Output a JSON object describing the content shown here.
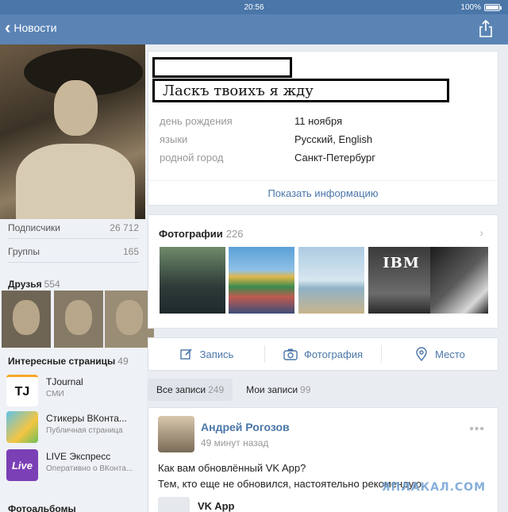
{
  "status_bar": {
    "time": "20:56",
    "battery": "100%"
  },
  "nav": {
    "back_label": "Новости"
  },
  "profile": {
    "status_text": "Ласкъ твоихъ я жду",
    "info": [
      {
        "key": "день рождения",
        "value": "11 ноября"
      },
      {
        "key": "языки",
        "value": "Русский, English"
      },
      {
        "key": "родной город",
        "value": "Санкт-Петербург"
      }
    ],
    "show_more": "Показать информацию"
  },
  "sidebar": {
    "stats": [
      {
        "label": "Подписчики",
        "value": "26 712"
      },
      {
        "label": "Группы",
        "value": "165"
      }
    ],
    "friends": {
      "title": "Друзья",
      "count": "554"
    },
    "interesting": {
      "title": "Интересные страницы",
      "count": "49"
    },
    "pages": [
      {
        "name": "TJournal",
        "sub": "СМИ",
        "icon": "TJ"
      },
      {
        "name": "Стикеры ВКонта...",
        "sub": "Публичная страница",
        "icon": ""
      },
      {
        "name": "LIVE Экспресс",
        "sub": "Оперативно о ВКонта...",
        "icon": "Live"
      }
    ],
    "albums_title": "Фотоальбомы"
  },
  "photos": {
    "title": "Фотографии",
    "count": "226",
    "thumb_text": "IBM"
  },
  "actions": [
    {
      "label": "Запись",
      "icon": "edit-icon"
    },
    {
      "label": "Фотография",
      "icon": "camera-icon"
    },
    {
      "label": "Место",
      "icon": "location-pin-icon"
    }
  ],
  "tabs": [
    {
      "label": "Все записи",
      "count": "249",
      "active": true
    },
    {
      "label": "Мои записи",
      "count": "99",
      "active": false
    }
  ],
  "post": {
    "author": "Андрей Рогозов",
    "time": "49 минут назад",
    "text_line1": "Как вам обновлённый VK App?",
    "text_line2": "Тем, кто еще не обновился, настоятельно рекомендую.",
    "attachment": "VK App"
  },
  "watermark": "ЯПЛАКАЛ.COM",
  "colors": {
    "header": "#5b84b5",
    "accent": "#4a76a8",
    "background": "#e9edf2"
  }
}
